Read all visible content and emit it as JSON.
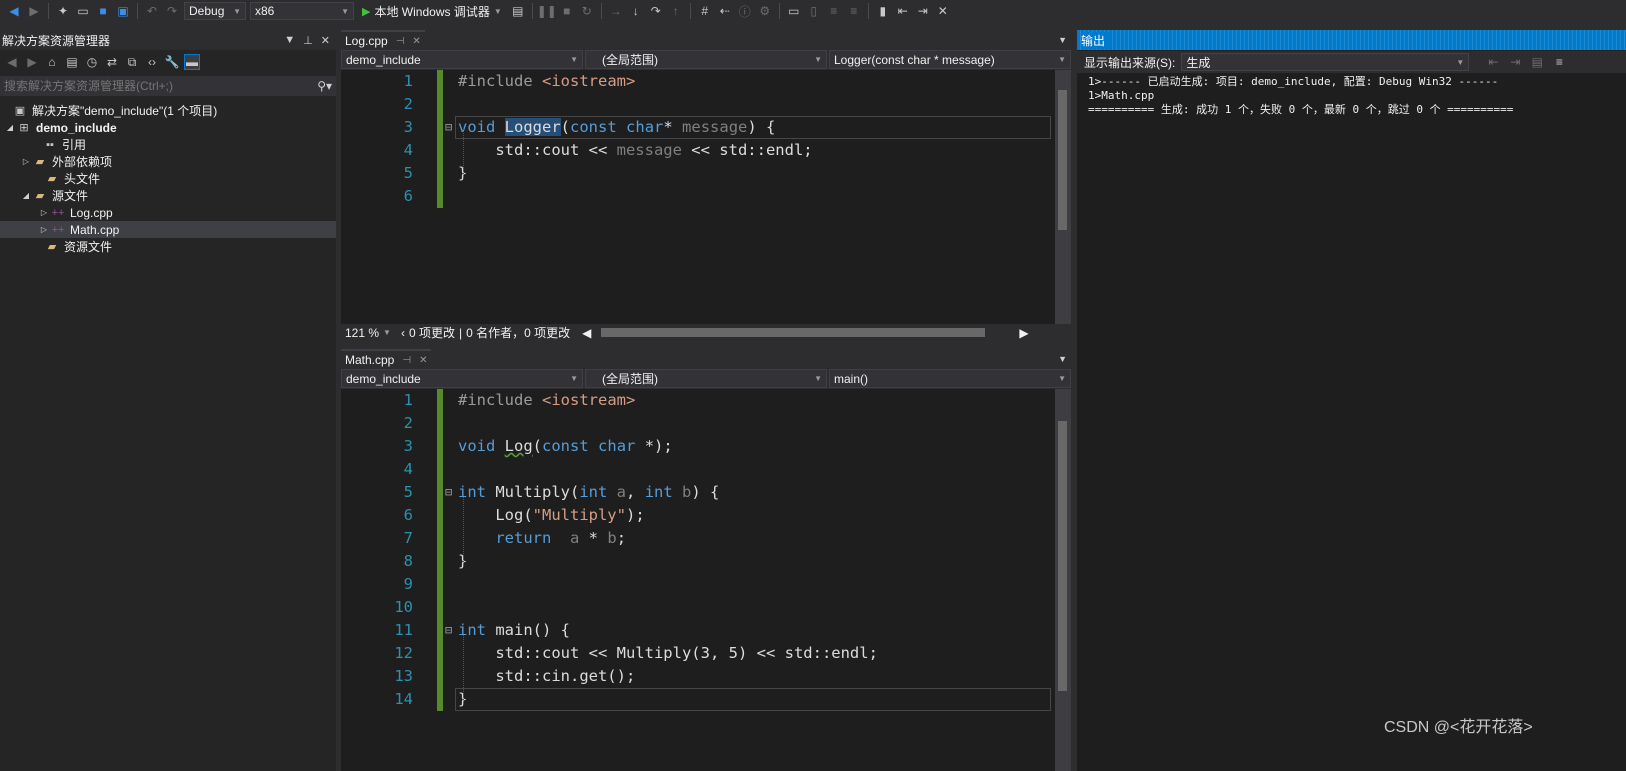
{
  "toolbar": {
    "config": "Debug",
    "platform": "x86",
    "run_label": "本地 Windows 调试器"
  },
  "solution_explorer": {
    "title": "解决方案资源管理器",
    "search_placeholder": "搜索解决方案资源管理器(Ctrl+;)",
    "solution": "解决方案\"demo_include\"(1 个项目)",
    "project": "demo_include",
    "items": [
      {
        "label": "引用"
      },
      {
        "label": "外部依赖项"
      },
      {
        "label": "头文件"
      },
      {
        "label": "源文件"
      },
      {
        "label": "Log.cpp"
      },
      {
        "label": "Math.cpp"
      },
      {
        "label": "资源文件"
      }
    ]
  },
  "editor_top": {
    "tab": "Log.cpp",
    "nav_project": "demo_include",
    "nav_scope": "(全局范围)",
    "nav_member": "Logger(const char * message)",
    "zoom": "121 %",
    "status_changes": "0 项更改",
    "status_authors": "0 名作者，0 项更改"
  },
  "editor_bottom": {
    "tab": "Math.cpp",
    "nav_project": "demo_include",
    "nav_scope": "(全局范围)",
    "nav_member": "main()"
  },
  "output": {
    "title": "输出",
    "source_label": "显示输出来源(S):",
    "source_value": "生成",
    "line1": "1>------ 已启动生成: 项目: demo_include, 配置: Debug Win32 ------",
    "line2": "1>Math.cpp",
    "line3": "========== 生成: 成功 1 个，失败 0 个，最新 0 个，跳过 0 个 =========="
  },
  "watermark": "CSDN @<花开花落>"
}
